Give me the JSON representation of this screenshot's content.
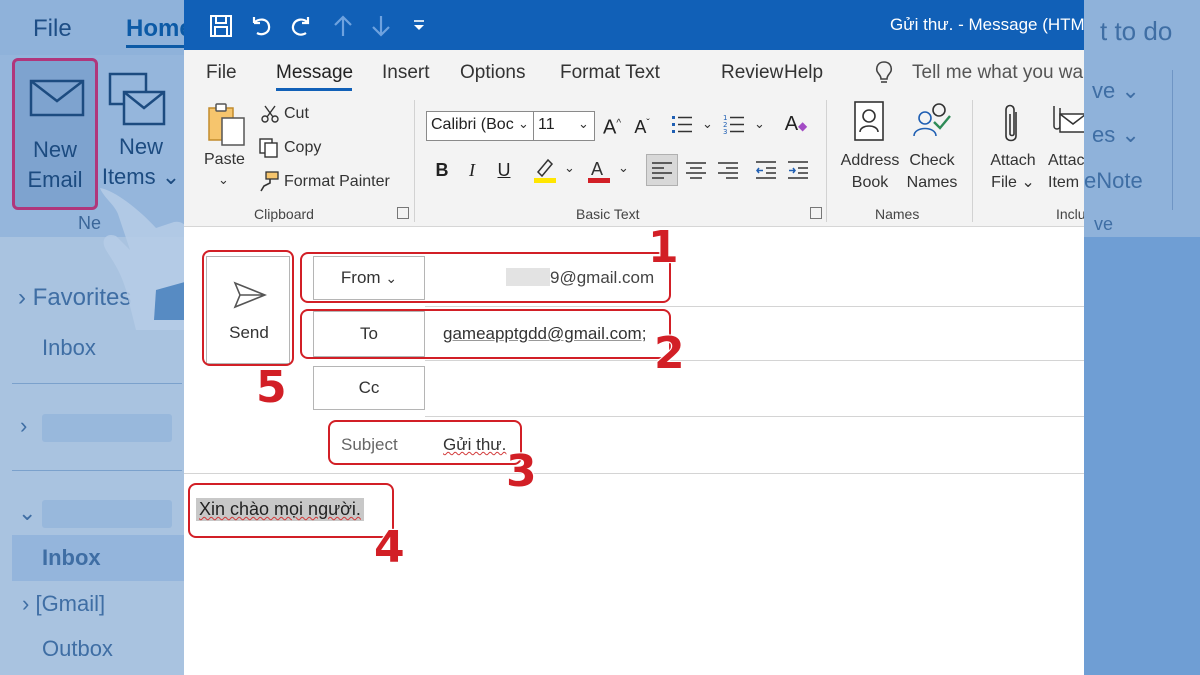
{
  "background_app": {
    "tabs": [
      "File",
      "Home"
    ],
    "new_email_label": [
      "New",
      "Email"
    ],
    "new_items_label": [
      "New",
      "Items"
    ],
    "group_label": "Ne",
    "right_partial": {
      "todo": "t to do",
      "ve": "ve",
      "es": "es",
      "enote": "eNote",
      "ve2": "ve"
    },
    "nav": {
      "favorites": "Favorites",
      "inbox_top": "Inbox",
      "inbox_bold": "Inbox",
      "gmail": "[Gmail]",
      "outbox": "Outbox"
    }
  },
  "titlebar": {
    "title": "Gửi thư. - Message (HTM"
  },
  "menu": {
    "items": [
      "File",
      "Message",
      "Insert",
      "Options",
      "Format Text",
      "Review",
      "Help"
    ],
    "active": "Message",
    "tell_me": "Tell me what you wa"
  },
  "ribbon": {
    "clipboard": {
      "paste": "Paste",
      "cut": "Cut",
      "copy": "Copy",
      "format_painter": "Format Painter",
      "label": "Clipboard"
    },
    "basic_text": {
      "font_name": "Calibri (Boc",
      "font_size": "11",
      "bold": "B",
      "italic": "I",
      "underline": "U",
      "label": "Basic Text"
    },
    "names": {
      "address_book": [
        "Address",
        "Book"
      ],
      "check_names": [
        "Check",
        "Names"
      ],
      "label": "Names"
    },
    "include": {
      "attach_file": [
        "Attach",
        "File"
      ],
      "attach_item": [
        "Attac",
        "Item"
      ],
      "label": "Inclu"
    }
  },
  "compose": {
    "send_label": "Send",
    "from_label": "From",
    "from_value": "9@gmail.com",
    "to_label": "To",
    "to_value": "gameapptgdd@gmail.com;",
    "cc_label": "Cc",
    "subject_label": "Subject",
    "subject_value": "Gửi thư.",
    "body": "Xin chào mọi người."
  },
  "annotations": [
    "1",
    "2",
    "3",
    "4",
    "5"
  ],
  "colors": {
    "titlebar": "#1160b7",
    "annotation_red": "#d21f26",
    "background_overlay": "#a9c3e0"
  }
}
